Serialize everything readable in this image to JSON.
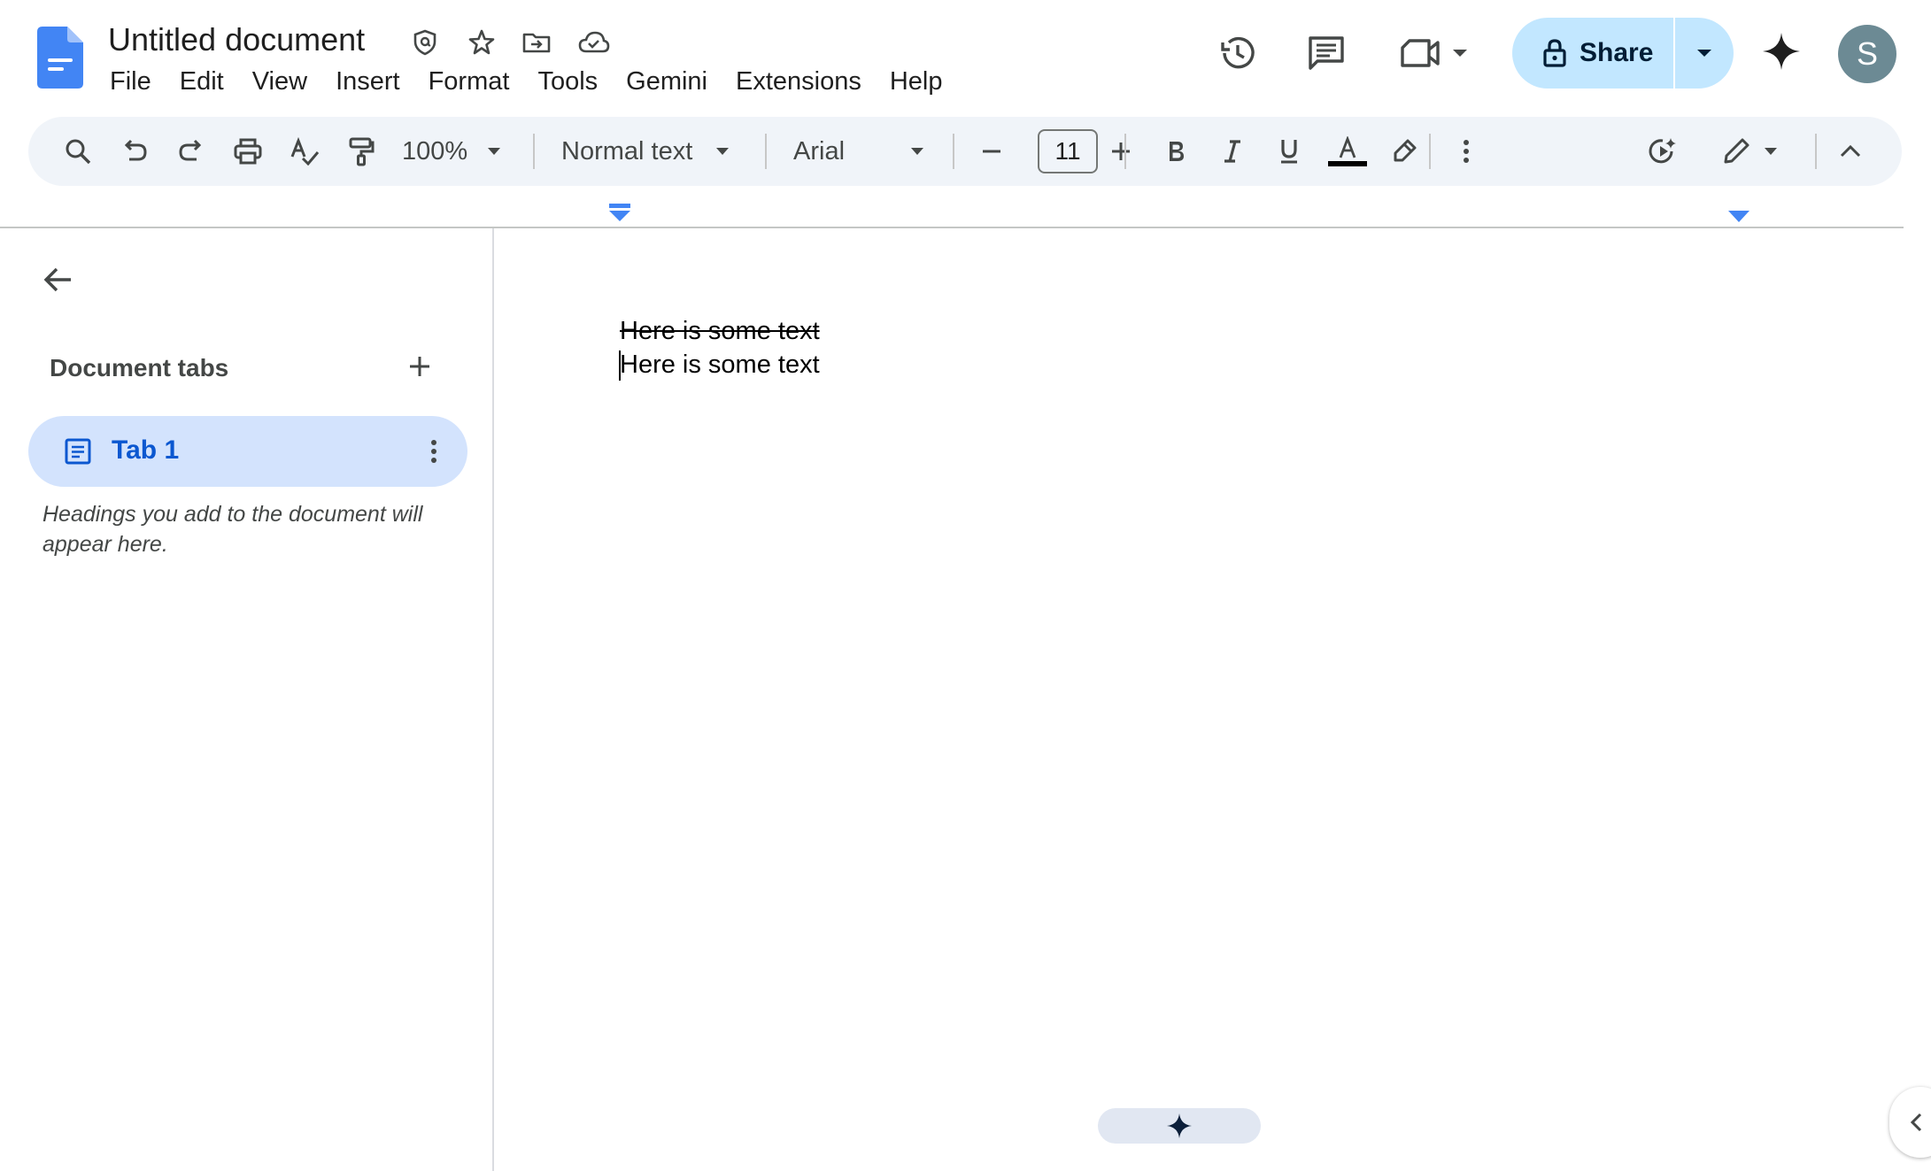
{
  "header": {
    "title": "Untitled document",
    "menu": [
      "File",
      "Edit",
      "View",
      "Insert",
      "Format",
      "Tools",
      "Gemini",
      "Extensions",
      "Help"
    ],
    "share_label": "Share",
    "avatar_initial": "S",
    "icons": [
      "docs-logo-icon",
      "security-badge-icon",
      "star-icon",
      "move-folder-icon",
      "cloud-saved-icon",
      "version-history-icon",
      "comments-icon",
      "meet-icon",
      "lock-icon",
      "gemini-icon"
    ]
  },
  "toolbar": {
    "zoom": "100%",
    "style": "Normal text",
    "font": "Arial",
    "font_size": "11",
    "text_color": "#000000"
  },
  "sidebar": {
    "heading": "Document tabs",
    "tabs": [
      {
        "label": "Tab 1"
      }
    ],
    "hint": "Headings you add to the document will appear here."
  },
  "document": {
    "lines": [
      {
        "text": "Here is some text",
        "strikethrough": true
      },
      {
        "text": "Here is some text",
        "strikethrough": false
      }
    ]
  },
  "colors": {
    "accent": "#0b57d0",
    "share_bg": "#c2e7ff",
    "toolbar_bg": "#f0f4f9",
    "tab_selected_bg": "#d3e3fd"
  }
}
